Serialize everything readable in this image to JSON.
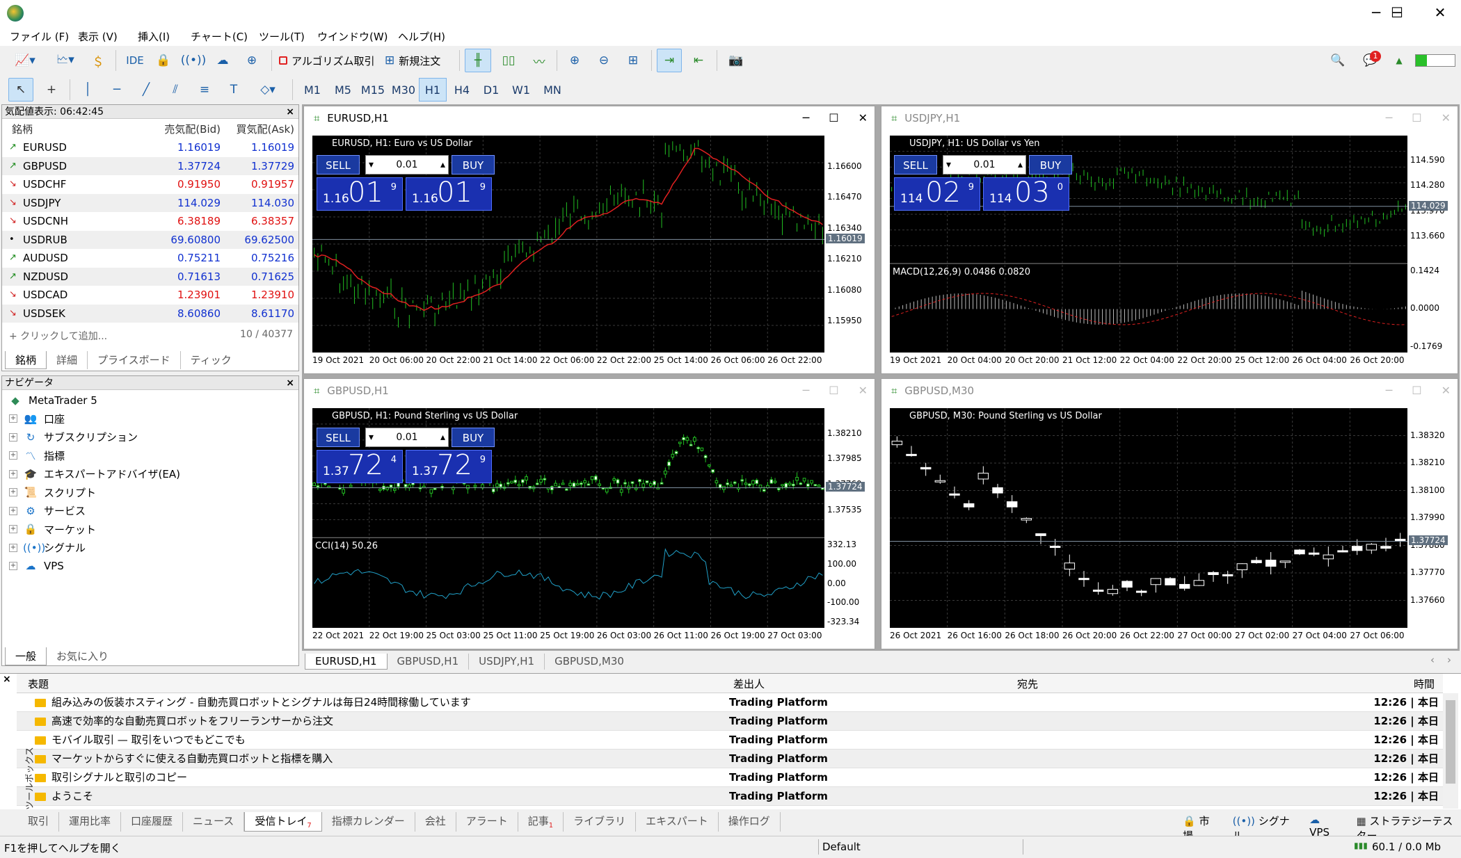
{
  "app": {
    "window_buttons": [
      "─",
      "☐",
      "✕"
    ]
  },
  "menu": [
    "ファイル (F)",
    "表示 (V)",
    "挿入(I)",
    "チャート(C)",
    "ツール(T)",
    "ウインドウ(W)",
    "ヘルプ(H)"
  ],
  "toolbar": {
    "ide_label": "IDE",
    "algo_label": "アルゴリズム取引",
    "neworder_label": "新規注文",
    "notif_count": "1",
    "timeframes": [
      "M1",
      "M5",
      "M15",
      "M30",
      "H1",
      "H4",
      "D1",
      "W1",
      "MN"
    ],
    "active_timeframe": "H1"
  },
  "market_watch": {
    "title": "気配値表示: 06:42:45",
    "col_symbol": "銘柄",
    "col_bid": "売気配(Bid)",
    "col_ask": "買気配(Ask)",
    "rows": [
      {
        "dir": "up",
        "symbol": "EURUSD",
        "bid": "1.16019",
        "ask": "1.16019",
        "color": "blue"
      },
      {
        "dir": "up",
        "symbol": "GBPUSD",
        "bid": "1.37724",
        "ask": "1.37729",
        "color": "blue"
      },
      {
        "dir": "dn",
        "symbol": "USDCHF",
        "bid": "0.91950",
        "ask": "0.91957",
        "color": "red"
      },
      {
        "dir": "dn",
        "symbol": "USDJPY",
        "bid": "114.029",
        "ask": "114.030",
        "color": "blue"
      },
      {
        "dir": "dn",
        "symbol": "USDCNH",
        "bid": "6.38189",
        "ask": "6.38357",
        "color": "red"
      },
      {
        "dir": "flat",
        "symbol": "USDRUB",
        "bid": "69.60800",
        "ask": "69.62500",
        "color": "blue"
      },
      {
        "dir": "up",
        "symbol": "AUDUSD",
        "bid": "0.75211",
        "ask": "0.75216",
        "color": "blue"
      },
      {
        "dir": "up",
        "symbol": "NZDUSD",
        "bid": "0.71613",
        "ask": "0.71625",
        "color": "blue"
      },
      {
        "dir": "dn",
        "symbol": "USDCAD",
        "bid": "1.23901",
        "ask": "1.23910",
        "color": "red"
      },
      {
        "dir": "dn",
        "symbol": "USDSEK",
        "bid": "8.60860",
        "ask": "8.61170",
        "color": "blue"
      }
    ],
    "add_label": "+ クリックして追加...",
    "count": "10 / 40377",
    "tabs": [
      "銘柄",
      "詳細",
      "プライスボード",
      "ティック"
    ]
  },
  "navigator": {
    "title": "ナビゲータ",
    "root": "MetaTrader 5",
    "items": [
      "口座",
      "サブスクリプション",
      "指標",
      "エキスパートアドバイザ(EA)",
      "スクリプト",
      "サービス",
      "マーケット",
      "シグナル",
      "VPS"
    ],
    "tabs": [
      "一般",
      "お気に入り"
    ]
  },
  "charts": [
    {
      "caption": "EURUSD,H1",
      "title": "EURUSD, H1:  Euro vs US Dollar",
      "lot": "0.01",
      "sell": {
        "small": "1.16",
        "big": "01",
        "tiny": "9"
      },
      "buy": {
        "small": "1.16",
        "big": "01",
        "tiny": "9"
      },
      "yticks": [
        "1.16600",
        "1.16470",
        "1.16340",
        "1.16210",
        "1.16080",
        "1.15950"
      ],
      "price_tag": "1.16019",
      "xticks": [
        "19 Oct 2021",
        "20 Oct 06:00",
        "20 Oct 22:00",
        "21 Oct 14:00",
        "22 Oct 06:00",
        "22 Oct 22:00",
        "25 Oct 14:00",
        "26 Oct 06:00",
        "26 Oct 22:00"
      ]
    },
    {
      "caption": "USDJPY,H1",
      "title": "USDJPY, H1:  US Dollar vs Yen",
      "lot": "0.01",
      "sell": {
        "small": "114",
        "big": "02",
        "tiny": "9"
      },
      "buy": {
        "small": "114",
        "big": "03",
        "tiny": "0"
      },
      "yticks": [
        "114.590",
        "114.280",
        "113.970",
        "113.660"
      ],
      "price_tag": "114.029",
      "macd_label": "MACD(12,26,9) 0.0486 0.0820",
      "macd_ticks": [
        "0.1424",
        "0.0000",
        "-0.1769"
      ],
      "xticks": [
        "19 Oct 2021",
        "20 Oct 04:00",
        "20 Oct 20:00",
        "21 Oct 12:00",
        "22 Oct 04:00",
        "22 Oct 20:00",
        "25 Oct 12:00",
        "26 Oct 04:00",
        "26 Oct 20:00"
      ]
    },
    {
      "caption": "GBPUSD,H1",
      "title": "GBPUSD, H1:  Pound Sterling vs US Dollar",
      "lot": "0.01",
      "sell": {
        "small": "1.37",
        "big": "72",
        "tiny": "4"
      },
      "buy": {
        "small": "1.37",
        "big": "72",
        "tiny": "9"
      },
      "yticks": [
        "1.38210",
        "1.37985",
        "1.37760",
        "1.37535"
      ],
      "price_tag": "1.37724",
      "cci_label": "CCI(14) 50.26",
      "cci_ticks": [
        "332.13",
        "100.00",
        "0.00",
        "-100.00",
        "-323.34"
      ],
      "xticks": [
        "22 Oct 2021",
        "22 Oct 19:00",
        "25 Oct 03:00",
        "25 Oct 11:00",
        "25 Oct 19:00",
        "26 Oct 03:00",
        "26 Oct 11:00",
        "26 Oct 19:00",
        "27 Oct 03:00"
      ]
    },
    {
      "caption": "GBPUSD,M30",
      "title": "GBPUSD, M30:  Pound Sterling vs US Dollar",
      "yticks": [
        "1.38320",
        "1.38210",
        "1.38100",
        "1.37990",
        "1.37880",
        "1.37770",
        "1.37660"
      ],
      "price_tag": "1.37724",
      "xticks": [
        "26 Oct 2021",
        "26 Oct 16:00",
        "26 Oct 18:00",
        "26 Oct 20:00",
        "26 Oct 22:00",
        "27 Oct 00:00",
        "27 Oct 02:00",
        "27 Oct 04:00",
        "27 Oct 06:00"
      ]
    }
  ],
  "chart_tabs": [
    "EURUSD,H1",
    "GBPUSD,H1",
    "USDJPY,H1",
    "GBPUSD,M30"
  ],
  "toolbox": {
    "vertical_label": "ツールボックス",
    "headers": {
      "subject": "表題",
      "from": "差出人",
      "to": "宛先",
      "time": "時間"
    },
    "messages": [
      {
        "subject": "組み込みの仮装ホスティング - 自動売買ロボットとシグナルは毎日24時間稼働しています",
        "from": "Trading Platform",
        "time": "12:26 | 本日"
      },
      {
        "subject": "高速で効率的な自動売買ロボットをフリーランサーから注文",
        "from": "Trading Platform",
        "time": "12:26 | 本日"
      },
      {
        "subject": "モバイル取引 — 取引をいつでもどこでも",
        "from": "Trading Platform",
        "time": "12:26 | 本日"
      },
      {
        "subject": "マーケットからすぐに使える自動売買ロボットと指標を購入",
        "from": "Trading Platform",
        "time": "12:26 | 本日"
      },
      {
        "subject": "取引シグナルと取引のコピー",
        "from": "Trading Platform",
        "time": "12:26 | 本日"
      },
      {
        "subject": "ようこそ",
        "from": "Trading Platform",
        "time": "12:26 | 本日"
      }
    ],
    "tabs": [
      "取引",
      "運用比率",
      "口座履歴",
      "ニュース",
      "受信トレイ",
      "指標カレンダー",
      "会社",
      "アラート",
      "記事",
      "ライブラリ",
      "エキスパート",
      "操作ログ"
    ],
    "inbox_badge": "7",
    "articles_badge": "1",
    "right_links": [
      "市場",
      "シグナル",
      "VPS",
      "ストラテジーテスター"
    ]
  },
  "status": {
    "help": "F1を押してヘルプを開く",
    "profile": "Default",
    "traffic": "60.1 / 0.0 Mb"
  }
}
